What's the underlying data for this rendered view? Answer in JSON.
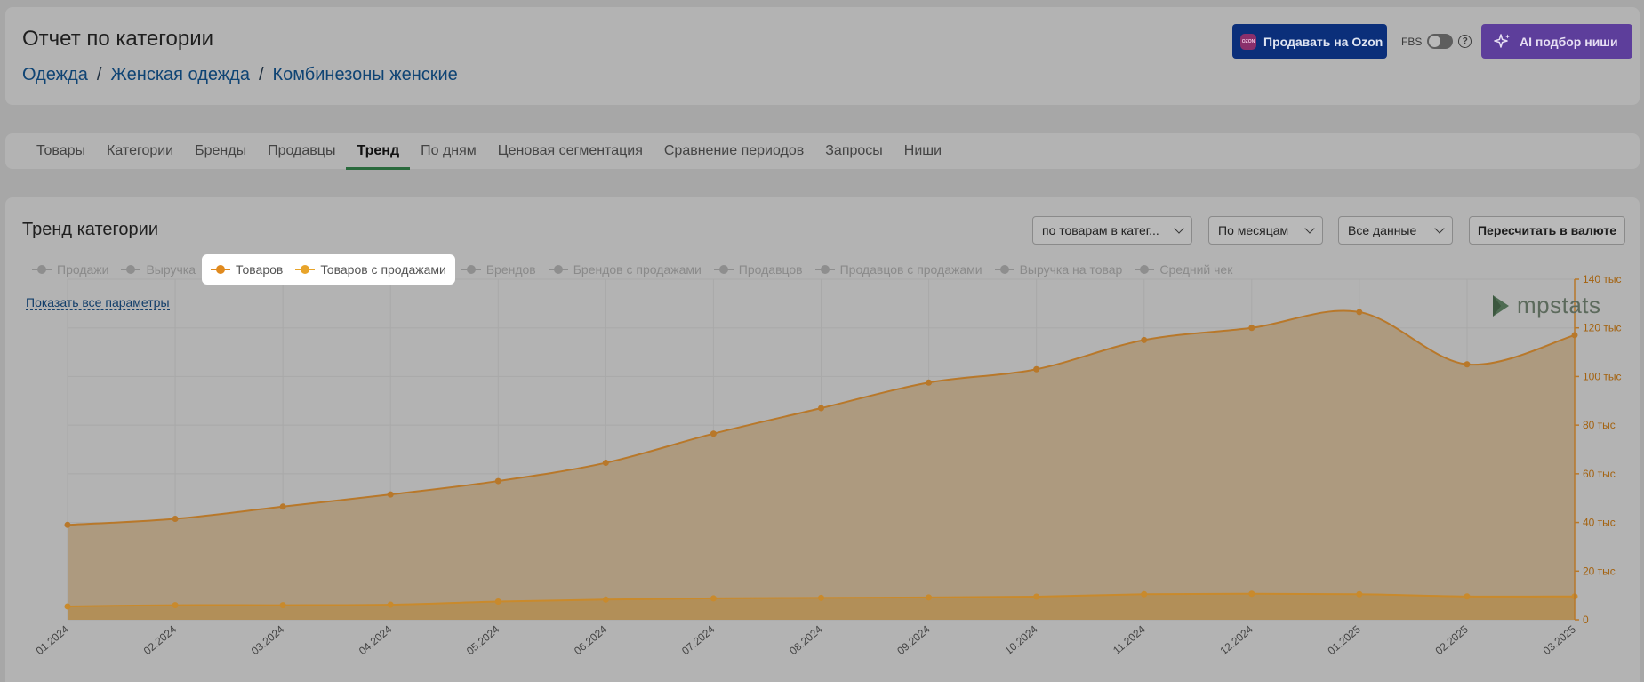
{
  "header": {
    "title": "Отчет по категории",
    "breadcrumb": [
      "Одежда",
      "Женская одежда",
      "Комбинезоны женские"
    ],
    "breadcrumb_sep": "/",
    "ozon_button": "Продавать на Ozon",
    "ozon_logo_text": "OZON",
    "fbs_label": "FBS",
    "help_glyph": "?",
    "ai_button": "AI подбор ниши"
  },
  "tabs": [
    {
      "label": "Товары",
      "active": false
    },
    {
      "label": "Категории",
      "active": false
    },
    {
      "label": "Бренды",
      "active": false
    },
    {
      "label": "Продавцы",
      "active": false
    },
    {
      "label": "Тренд",
      "active": true
    },
    {
      "label": "По дням",
      "active": false
    },
    {
      "label": "Ценовая сегментация",
      "active": false
    },
    {
      "label": "Сравнение периодов",
      "active": false
    },
    {
      "label": "Запросы",
      "active": false
    },
    {
      "label": "Ниши",
      "active": false
    }
  ],
  "trend": {
    "title": "Тренд категории",
    "scope_select": "по товарам в катег...",
    "period_select": "По месяцам",
    "data_select": "Все данные",
    "recalc_button": "Пересчитать в валюте",
    "show_all": "Показать все параметры",
    "brand": "mpstats",
    "legend": [
      {
        "label": "Продажи",
        "on": false
      },
      {
        "label": "Выручка",
        "on": false
      },
      {
        "label": "Товаров",
        "on": true,
        "color": "#e08a1e"
      },
      {
        "label": "Товаров с продажами",
        "on": true,
        "color": "#e8a42a"
      },
      {
        "label": "Брендов",
        "on": false
      },
      {
        "label": "Брендов с продажами",
        "on": false
      },
      {
        "label": "Продавцов",
        "on": false
      },
      {
        "label": "Продавцов с продажами",
        "on": false
      },
      {
        "label": "Выручка на товар",
        "on": false
      },
      {
        "label": "Средний чек",
        "on": false
      }
    ]
  },
  "chart_data": {
    "type": "area",
    "x": [
      "01.2024",
      "02.2024",
      "03.2024",
      "04.2024",
      "05.2024",
      "06.2024",
      "07.2024",
      "08.2024",
      "09.2024",
      "10.2024",
      "11.2024",
      "12.2024",
      "01.2025",
      "02.2025",
      "03.2025"
    ],
    "series": [
      {
        "name": "Товаров",
        "color": "#b8782a",
        "values": [
          39000,
          41500,
          46500,
          51500,
          57000,
          64500,
          76500,
          87000,
          97500,
          103000,
          115000,
          120000,
          126500,
          105000,
          117000
        ]
      },
      {
        "name": "Товаров с продажами",
        "color": "#c98a2c",
        "values": [
          5500,
          6000,
          6000,
          6200,
          7500,
          8300,
          8800,
          9000,
          9200,
          9500,
          10500,
          10700,
          10500,
          9600,
          9600
        ]
      }
    ],
    "ylim": [
      0,
      140000
    ],
    "y_ticks": [
      {
        "value": 0,
        "label": "0"
      },
      {
        "value": 20000,
        "label": "20 тыс"
      },
      {
        "value": 40000,
        "label": "40 тыс"
      },
      {
        "value": 60000,
        "label": "60 тыс"
      },
      {
        "value": 80000,
        "label": "80 тыс"
      },
      {
        "value": 100000,
        "label": "100 тыс"
      },
      {
        "value": 120000,
        "label": "120 тыс"
      },
      {
        "value": 140000,
        "label": "140 тыс"
      }
    ],
    "y_axis_side": "right",
    "grid": true
  }
}
